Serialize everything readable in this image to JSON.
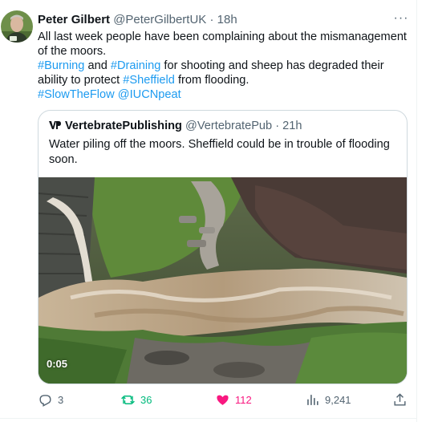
{
  "tweet": {
    "author_name": "Peter Gilbert",
    "author_handle": "@PeterGilbertUK",
    "separator": "·",
    "time": "18h",
    "more_label": "···",
    "line1": "All last week people have been complaining about the mismanagement of the moors.",
    "line2": {
      "tag1": "#Burning",
      "and": " and ",
      "tag2": "#Draining",
      "rest": " for shooting and sheep has degraded their ability to protect ",
      "tag3": "#Sheffield",
      "end": " from flooding."
    },
    "line3": {
      "tag4": "#SlowTheFlow",
      "space": " ",
      "mention": "@IUCNpeat"
    }
  },
  "quoted": {
    "author_name": "VertebratePublishing",
    "author_handle": "@VertebratePub",
    "separator": "·",
    "time": "21h",
    "text": "Water piling off the moors. Sheffield could be in trouble of flooding soon.",
    "video_duration": "0:05"
  },
  "actions": {
    "replies": "3",
    "reposts": "36",
    "likes": "112",
    "views": "9,241"
  },
  "colors": {
    "link": "#1d9bf0",
    "repost": "#00ba7c",
    "like": "#f91880",
    "muted": "#536471"
  },
  "icons": [
    "reply-icon",
    "repost-icon",
    "heart-icon",
    "views-icon",
    "share-icon",
    "more-icon"
  ]
}
